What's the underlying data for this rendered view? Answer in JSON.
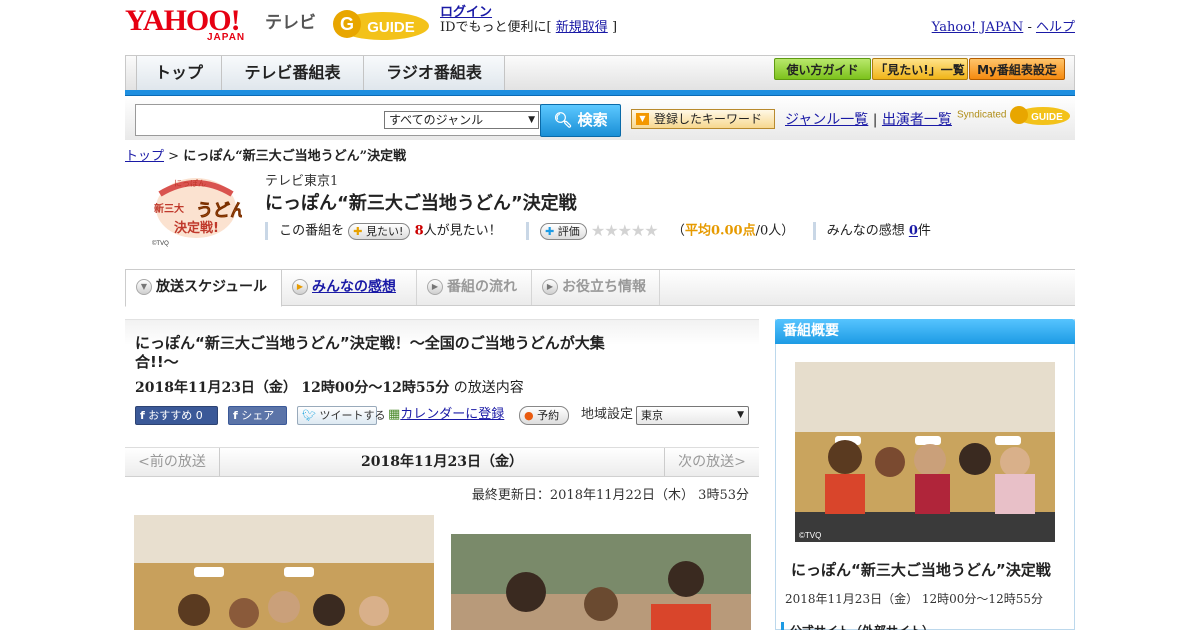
{
  "header": {
    "logo_main": "YAHOO!",
    "logo_sub": "JAPAN",
    "logo_tv": "テレビ",
    "gguide": "GUIDE",
    "login": "ログイン",
    "login_note_pre": "IDでもっと便利に[",
    "signup": "新規取得",
    "login_note_post": "]",
    "yahoo_japan_link": "Yahoo! JAPAN",
    "separator": "-",
    "help_link": "ヘルプ"
  },
  "nav": {
    "tabs": [
      "トップ",
      "テレビ番組表",
      "ラジオ番組表"
    ],
    "buttons": [
      "使い方ガイド",
      "「見たい!」一覧",
      "My番組表設定"
    ]
  },
  "search": {
    "genre": "すべてのジャンル",
    "button": "検索",
    "keyword_button": "登録したキーワード",
    "genre_list": "ジャンル一覧",
    "link_separator": "|",
    "cast_list": "出演者一覧",
    "syndicated": "Syndicated"
  },
  "breadcrumb": {
    "top": "トップ",
    "sep": ">",
    "current": "にっぽん“新三大ご当地うどん”決定戦"
  },
  "program": {
    "logo_text_a": "にっぽん",
    "logo_text_b": "新三大",
    "logo_text_c": "うどん",
    "logo_text_d": "決定戦!",
    "logo_credit": "©TVQ",
    "channel": "テレビ東京1",
    "title": "にっぽん“新三大ご当地うどん”決定戦",
    "want_prefix": "この番組を",
    "want_button": "見たい!",
    "want_count": "8",
    "want_suffix": "人が見たい！",
    "rate_button": "評価",
    "stars": "★★★★★",
    "avg_prefix": "（",
    "avg_label": "平均0.00点",
    "avg_suffix": "/0人）",
    "impressions_label": "みんなの感想",
    "impressions_count": "0",
    "impressions_suffix": "件"
  },
  "tabs": [
    "放送スケジュール",
    "みんなの感想",
    "番組の流れ",
    "お役立ち情報"
  ],
  "episode": {
    "title": "にっぽん“新三大ご当地うどん”決定戦！～全国のご当地うどんが大集合!!～",
    "date": "2018年11月23日（金）",
    "time": "12時00分～12時55分",
    "date_suffix": "の放送内容",
    "fb_recommend": "おすすめ 0",
    "fb_share": "シェア",
    "tweet": "ツイートする",
    "calendar": "カレンダーに登録",
    "reserve": "予約",
    "region_label": "地域設定",
    "region": "東京"
  },
  "pager": {
    "prev": "<前の放送",
    "date": "2018年11月23日（金）",
    "next": "次の放送>"
  },
  "updated": "最終更新日：2018年11月22日（木） 3時53分",
  "side": {
    "header": "番組概要",
    "photo_credit": "©TVQ",
    "title": "にっぽん“新三大ご当地うどん”決定戦",
    "date": "2018年11月23日（金） 12時00分～12時55分",
    "official": "公式サイト（外部サイト）"
  },
  "colors": {
    "yahoo_red": "#e60012",
    "nav_blue": "#1e8fe0",
    "link": "#1a1aa6",
    "button_gold": "#f0b418"
  }
}
